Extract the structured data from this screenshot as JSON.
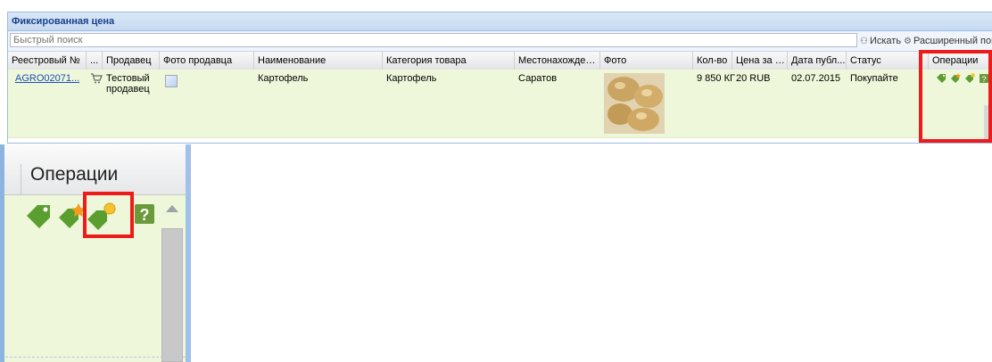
{
  "panel": {
    "title": "Фиксированная цена"
  },
  "toolbar": {
    "search_placeholder": "Быстрый поиск",
    "search_button": "Искать",
    "advanced_search_button": "Расширенный поис"
  },
  "grid": {
    "columns": [
      "Реестровый №",
      "...",
      "Продавец",
      "Фото продавца",
      "Наименование",
      "Категория товара",
      "Местонахождени...",
      "Фото",
      "Кол-во",
      "Цена за ед...",
      "Дата публ...",
      "Статус",
      "Операции"
    ],
    "rows": [
      {
        "registry_no": "AGRO02071...",
        "seller": "Тестовый продавец",
        "name": "Картофель",
        "category": "Картофель",
        "location": "Саратов",
        "quantity": "9 850 КГ",
        "price": "20 RUB",
        "published": "02.07.2015",
        "status": "Покупайте"
      }
    ]
  },
  "zoom": {
    "title": "Операции"
  },
  "colors": {
    "highlight": "#ee1b1b",
    "row_bg": "#eef7d9",
    "header_text": "#15428b",
    "icon_green": "#5a9e2f"
  },
  "icons": [
    "cart-icon",
    "tag-icon",
    "tag-star-icon",
    "tag-coin-icon",
    "help-icon"
  ]
}
